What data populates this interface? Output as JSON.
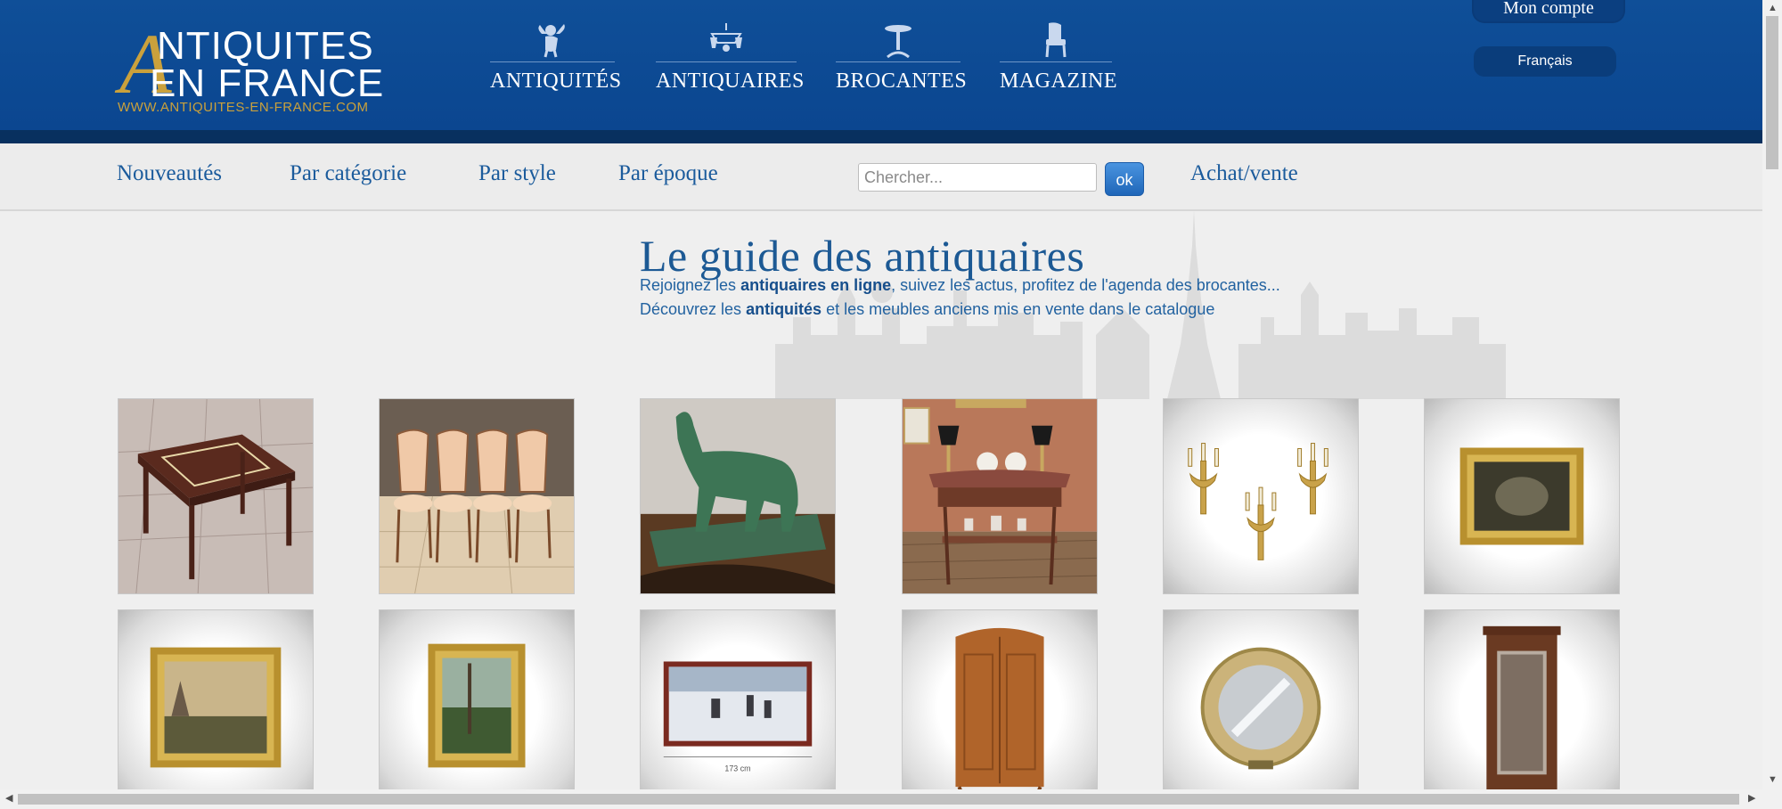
{
  "logo": {
    "letter": "A",
    "line1": "NTIQUITES",
    "line2": "EN FRANCE",
    "url": "WWW.ANTIQUITES-EN-FRANCE.COM",
    "gold": "#caa13c"
  },
  "main_nav": [
    {
      "label": "ANTIQUITÉS",
      "icon": "cherub-icon"
    },
    {
      "label": "ANTIQUAIRES",
      "icon": "chandelier-icon"
    },
    {
      "label": "BROCANTES",
      "icon": "pedestal-table-icon"
    },
    {
      "label": "MAGAZINE",
      "icon": "armchair-icon"
    }
  ],
  "account": {
    "label": "Mon compte"
  },
  "language": {
    "selected": "Français"
  },
  "sub_nav": [
    {
      "label": "Nouveautés"
    },
    {
      "label": "Par catégorie"
    },
    {
      "label": "Par style"
    },
    {
      "label": "Par époque"
    }
  ],
  "search": {
    "placeholder": "Chercher...",
    "button": "ok"
  },
  "achat_vente": "Achat/vente",
  "hero": {
    "title": "Le guide des antiquaires",
    "line1_a": "Rejoignez les ",
    "line1_b": "antiquaires en ligne",
    "line1_c": ", suivez les actus, profitez de l'agenda des brocantes...",
    "line2_a": "Découvrez les ",
    "line2_b": "antiquités",
    "line2_c": " et les meubles anciens mis en vente dans le catalogue"
  },
  "products": [
    {
      "name": "inlaid-side-table"
    },
    {
      "name": "four-upholstered-chairs"
    },
    {
      "name": "green-horse-sculpture"
    },
    {
      "name": "marble-console-table"
    },
    {
      "name": "gilt-wall-sconces"
    },
    {
      "name": "gilt-framed-painting-dark"
    },
    {
      "name": "framed-landscape-painting"
    },
    {
      "name": "framed-forest-painting"
    },
    {
      "name": "framed-winter-painting",
      "caption": "173 cm"
    },
    {
      "name": "wooden-armoire"
    },
    {
      "name": "porthole-mirror"
    },
    {
      "name": "mirror-wardrobe"
    }
  ],
  "colors": {
    "header_blue": "#0f4f98",
    "link_blue": "#1b5b9c"
  }
}
